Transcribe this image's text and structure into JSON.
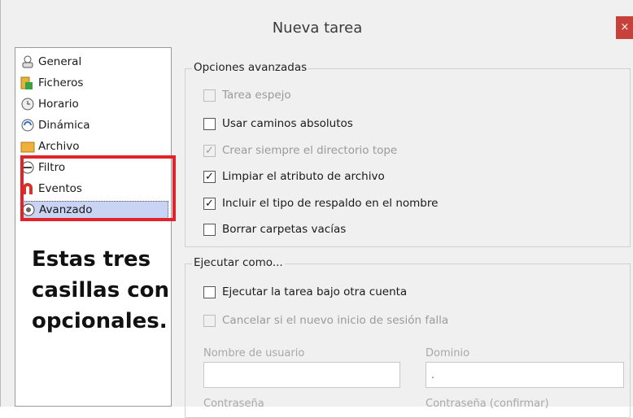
{
  "window": {
    "title": "Nueva tarea",
    "close_glyph": "×"
  },
  "sidebar": {
    "items": [
      {
        "label": "General",
        "icon": "user-icon"
      },
      {
        "label": "Ficheros",
        "icon": "files-icon"
      },
      {
        "label": "Horario",
        "icon": "clock-icon"
      },
      {
        "label": "Dinámica",
        "icon": "dynamic-icon"
      },
      {
        "label": "Archivo",
        "icon": "folder-icon"
      },
      {
        "label": "Filtro",
        "icon": "filter-icon"
      },
      {
        "label": "Eventos",
        "icon": "magnet-icon"
      },
      {
        "label": "Avanzado",
        "icon": "gear-icon",
        "selected": true
      }
    ]
  },
  "annotation": {
    "lines": [
      "Estas tres",
      "casillas con",
      "opcionales."
    ],
    "highlight_color": "#e0242a"
  },
  "advanced": {
    "title": "Opciones avanzadas",
    "options": [
      {
        "label": "Tarea espejo",
        "checked": false,
        "disabled": true
      },
      {
        "label": "Usar caminos absolutos",
        "checked": false,
        "disabled": false
      },
      {
        "label": "Crear siempre el directorio tope",
        "checked": true,
        "disabled": true
      },
      {
        "label": "Limpiar el atributo de archivo",
        "checked": true,
        "disabled": false
      },
      {
        "label": "Incluir el tipo de respaldo en el nombre",
        "checked": true,
        "disabled": false
      },
      {
        "label": "Borrar carpetas vacías",
        "checked": false,
        "disabled": false
      }
    ]
  },
  "run_as": {
    "title": "Ejecutar como...",
    "options": [
      {
        "label": "Ejecutar la tarea bajo otra cuenta",
        "checked": false,
        "disabled": false
      },
      {
        "label": "Cancelar si el nuevo inicio de sesión falla",
        "checked": false,
        "disabled": true
      }
    ],
    "username_label": "Nombre de usuario",
    "username_value": "",
    "domain_label": "Dominio",
    "domain_value": ".",
    "password_label": "Contraseña",
    "password_confirm_label": "Contraseña (confirmar)"
  }
}
